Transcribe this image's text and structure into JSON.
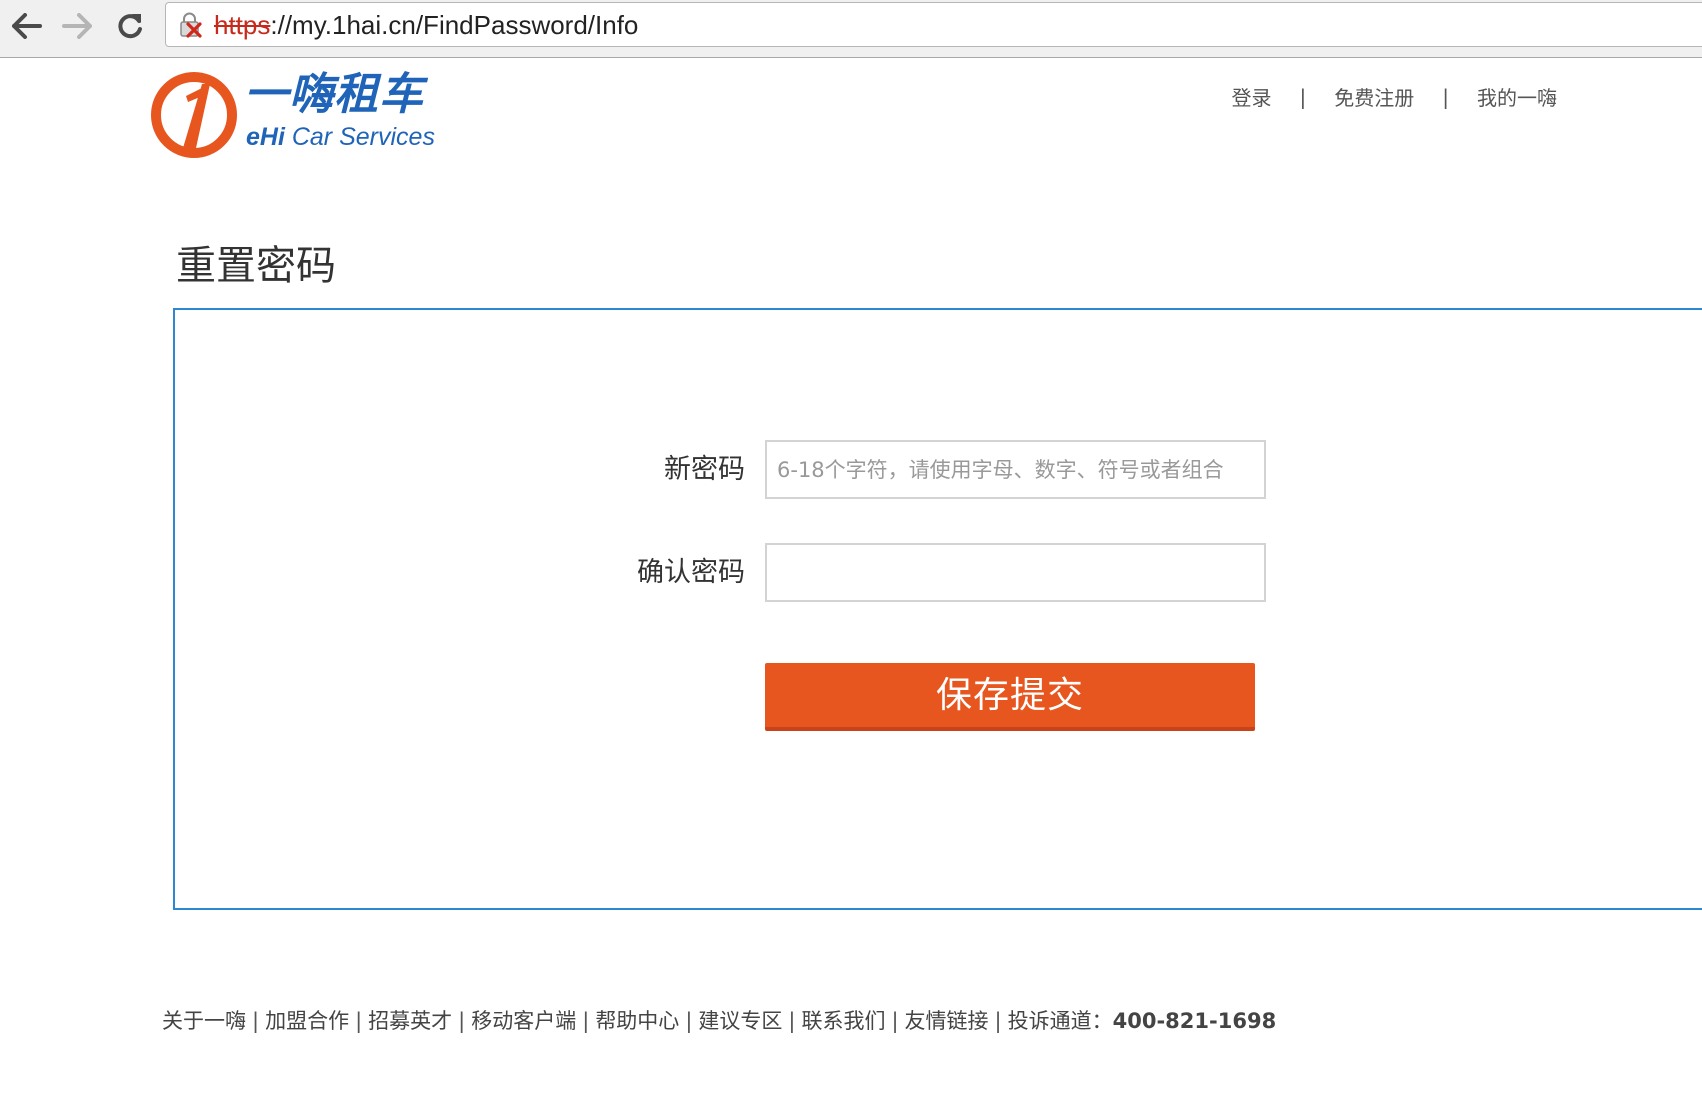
{
  "browser": {
    "url_scheme": "https",
    "url_rest": "://my.1hai.cn/FindPassword/Info"
  },
  "header": {
    "logo_cn": "一嗨租车",
    "logo_en_brand": "eHi",
    "logo_en_rest": " Car Services",
    "links": [
      {
        "label": "登录"
      },
      {
        "label": "免费注册"
      },
      {
        "label": "我的一嗨"
      }
    ],
    "separator": "|"
  },
  "page": {
    "title": "重置密码"
  },
  "form": {
    "new_password_label": "新密码",
    "new_password_placeholder": "6-18个字符，请使用字母、数字、符号或者组合",
    "new_password_value": "",
    "confirm_password_label": "确认密码",
    "confirm_password_value": "",
    "submit_label": "保存提交"
  },
  "footer": {
    "links": [
      {
        "label": "关于一嗨"
      },
      {
        "label": "加盟合作"
      },
      {
        "label": "招募英才"
      },
      {
        "label": "移动客户端"
      },
      {
        "label": "帮助中心"
      },
      {
        "label": "建议专区"
      },
      {
        "label": "联系我们"
      },
      {
        "label": "友情链接"
      }
    ],
    "hotline_label": "投诉通道：",
    "hotline_number": "400-821-1698",
    "separator": "|"
  },
  "colors": {
    "brand_blue": "#1f64b8",
    "brand_orange": "#e8561f",
    "panel_border": "#2f86d1",
    "insecure_scheme": "#c62a1c"
  }
}
